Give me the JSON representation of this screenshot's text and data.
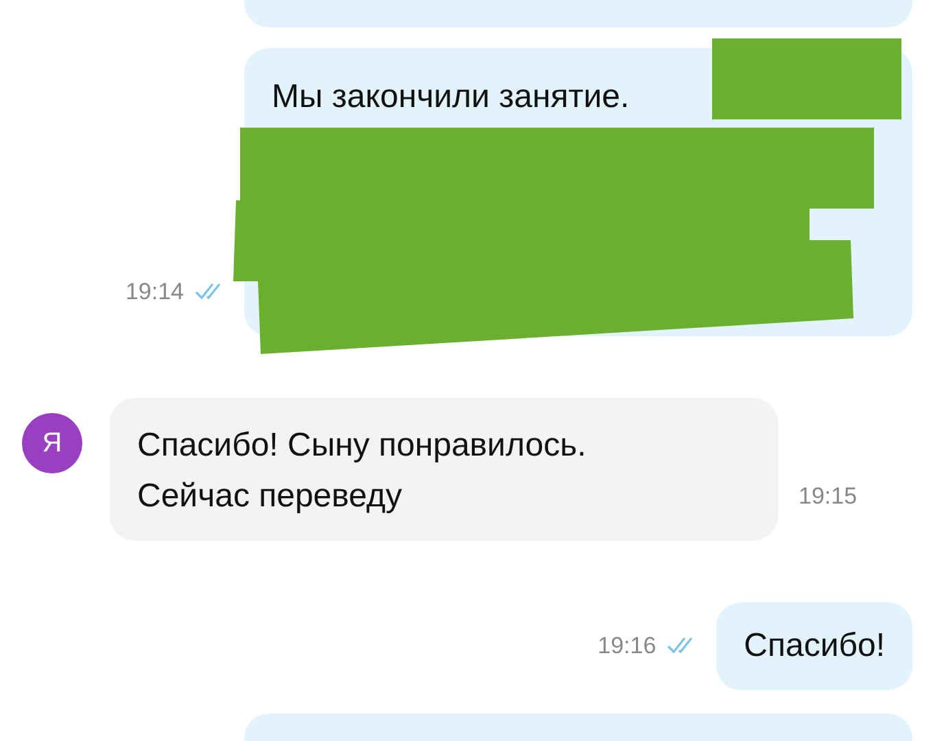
{
  "messages": [
    {
      "kind": "outgoing"
    },
    {
      "kind": "outgoing",
      "text": "Мы закончили занятие.",
      "time": "19:14",
      "read": true,
      "redacted": true
    },
    {
      "kind": "incoming",
      "avatar": "Я",
      "text": "Спасибо! Сыну понравилось.\nСейчас переведу",
      "time": "19:15"
    },
    {
      "kind": "outgoing",
      "text": "Спасибо!",
      "time": "19:16",
      "read": true
    },
    {
      "kind": "outgoing"
    }
  ]
}
